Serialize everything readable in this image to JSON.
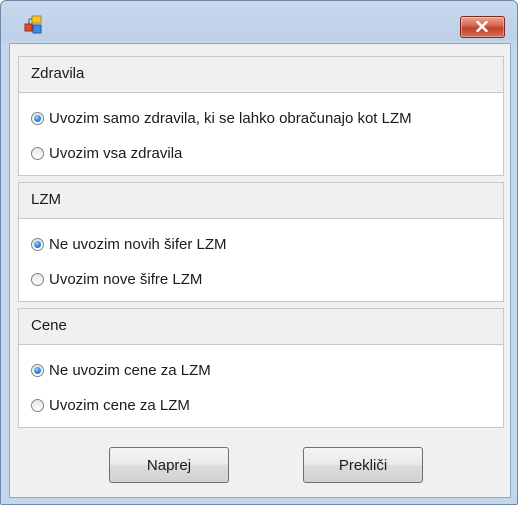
{
  "window": {
    "close_icon": "close-x-icon",
    "app_icon": "app-blocks-icon"
  },
  "groups": [
    {
      "title": "Zdravila",
      "options": [
        {
          "label": "Uvozim samo zdravila, ki se lahko obračunajo kot LZM",
          "checked": true
        },
        {
          "label": "Uvozim vsa zdravila",
          "checked": false
        }
      ]
    },
    {
      "title": "LZM",
      "options": [
        {
          "label": "Ne uvozim novih šifer LZM",
          "checked": true
        },
        {
          "label": "Uvozim nove šifre LZM",
          "checked": false
        }
      ]
    },
    {
      "title": "Cene",
      "options": [
        {
          "label": "Ne uvozim cene za LZM",
          "checked": true
        },
        {
          "label": "Uvozim cene za LZM",
          "checked": false
        }
      ]
    }
  ],
  "buttons": {
    "next_label": "Naprej",
    "cancel_label": "Prekliči"
  },
  "colors": {
    "close_button": "#c0402b",
    "radio_selected": "#2f7ed8"
  }
}
